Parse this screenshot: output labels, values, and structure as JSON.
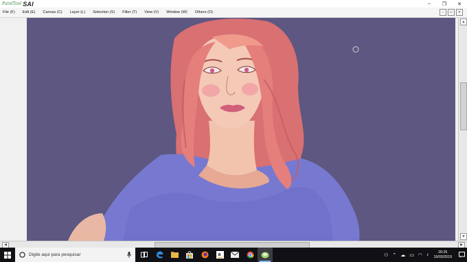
{
  "app": {
    "brand_small": "PaintTool",
    "brand_big": "SAI"
  },
  "window_buttons": [
    "–",
    "❐",
    "✕"
  ],
  "menu": [
    {
      "label": "File (F)"
    },
    {
      "label": "Edit (E)"
    },
    {
      "label": "Canvas (C)"
    },
    {
      "label": "Layer (L)"
    },
    {
      "label": "Selection (S)"
    },
    {
      "label": "Filter (T)"
    },
    {
      "label": "View (V)"
    },
    {
      "label": "Window (W)"
    },
    {
      "label": "Others (O)"
    }
  ],
  "mdi_buttons": [
    "–",
    "▭",
    "✕"
  ],
  "canvas": {
    "background": "#5d5781",
    "artwork": "digital painting of a woman with long pink hair wearing a purple shirt"
  },
  "taskbar": {
    "search_placeholder": "Digite aqui para pesquisar",
    "apps": [
      "task-view-icon",
      "edge-icon",
      "file-explorer-icon",
      "store-icon",
      "firefox-icon",
      "amazon-icon",
      "mail-icon",
      "chrome-icon",
      "painttool-sai-icon"
    ],
    "clock_time": "20:25",
    "clock_date": "19/03/2019"
  }
}
